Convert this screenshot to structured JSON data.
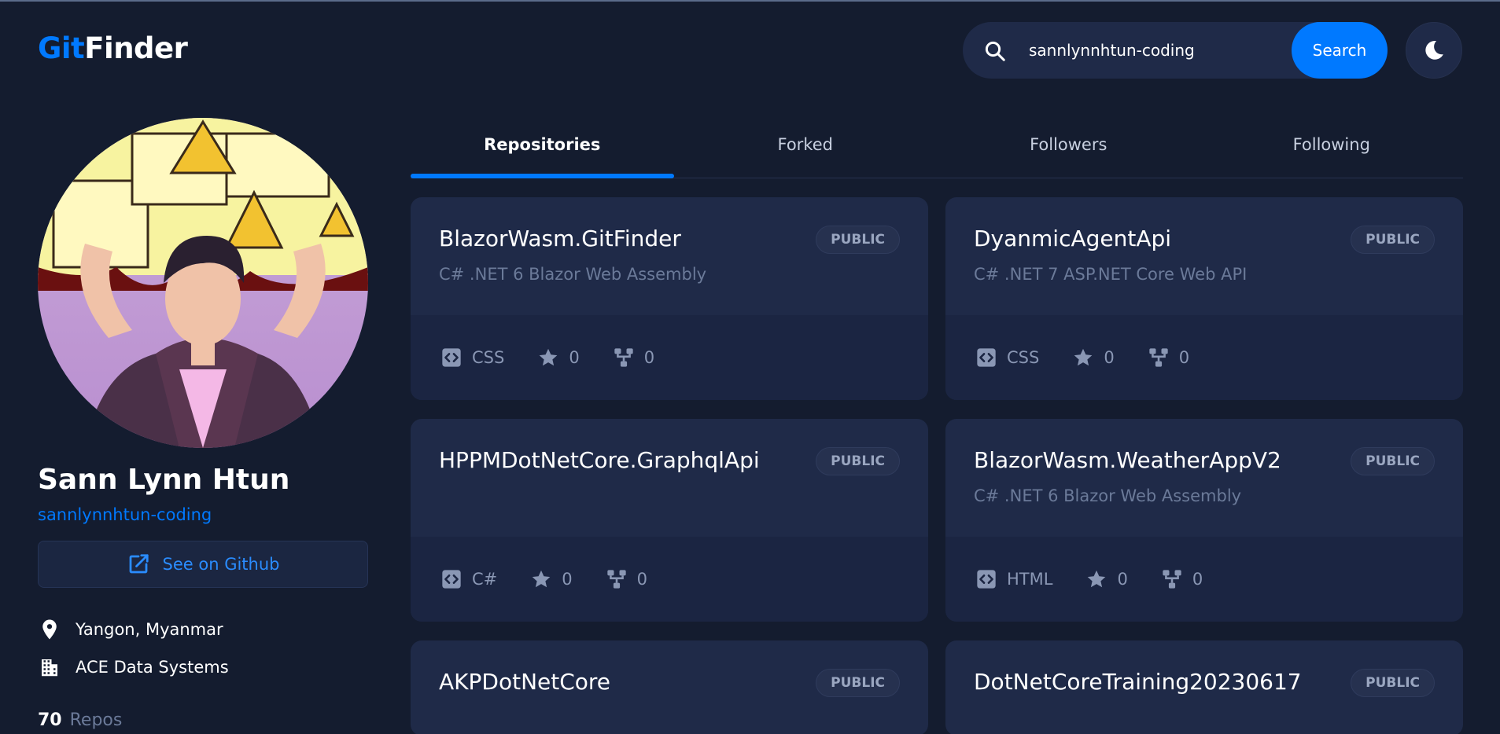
{
  "logo": {
    "part1": "Git",
    "part2": "Finder"
  },
  "search": {
    "value": "sannlynnhtun-coding",
    "button_label": "Search",
    "icon": "search-icon"
  },
  "theme_toggle": {
    "icon": "moon-icon"
  },
  "profile": {
    "name": "Sann Lynn Htun",
    "login": "sannlynnhtun-coding",
    "github_button": "See on Github",
    "location": "Yangon, Myanmar",
    "company": "ACE Data Systems",
    "repos_count": "70",
    "repos_label": "Repos"
  },
  "tabs": [
    {
      "label": "Repositories",
      "active": true
    },
    {
      "label": "Forked",
      "active": false
    },
    {
      "label": "Followers",
      "active": false
    },
    {
      "label": "Following",
      "active": false
    }
  ],
  "repos": [
    {
      "name": "BlazorWasm.GitFinder",
      "badge": "PUBLIC",
      "description": "C# .NET 6 Blazor Web Assembly",
      "language": "CSS",
      "stars": "0",
      "forks": "0"
    },
    {
      "name": "DyanmicAgentApi",
      "badge": "PUBLIC",
      "description": "C# .NET 7 ASP.NET Core Web API",
      "language": "CSS",
      "stars": "0",
      "forks": "0"
    },
    {
      "name": "HPPMDotNetCore.GraphqlApi",
      "badge": "PUBLIC",
      "description": "",
      "language": "C#",
      "stars": "0",
      "forks": "0"
    },
    {
      "name": "BlazorWasm.WeatherAppV2",
      "badge": "PUBLIC",
      "description": "C# .NET 6 Blazor Web Assembly",
      "language": "HTML",
      "stars": "0",
      "forks": "0"
    },
    {
      "name": "AKPDotNetCore",
      "badge": "PUBLIC",
      "description": "",
      "language": "",
      "stars": "",
      "forks": ""
    },
    {
      "name": "DotNetCoreTraining20230617",
      "badge": "PUBLIC",
      "description": "",
      "language": "",
      "stars": "",
      "forks": ""
    }
  ],
  "colors": {
    "background": "#141c2f",
    "card": "#1f2a48",
    "accent": "#0079ff",
    "muted": "#6b7a99"
  }
}
